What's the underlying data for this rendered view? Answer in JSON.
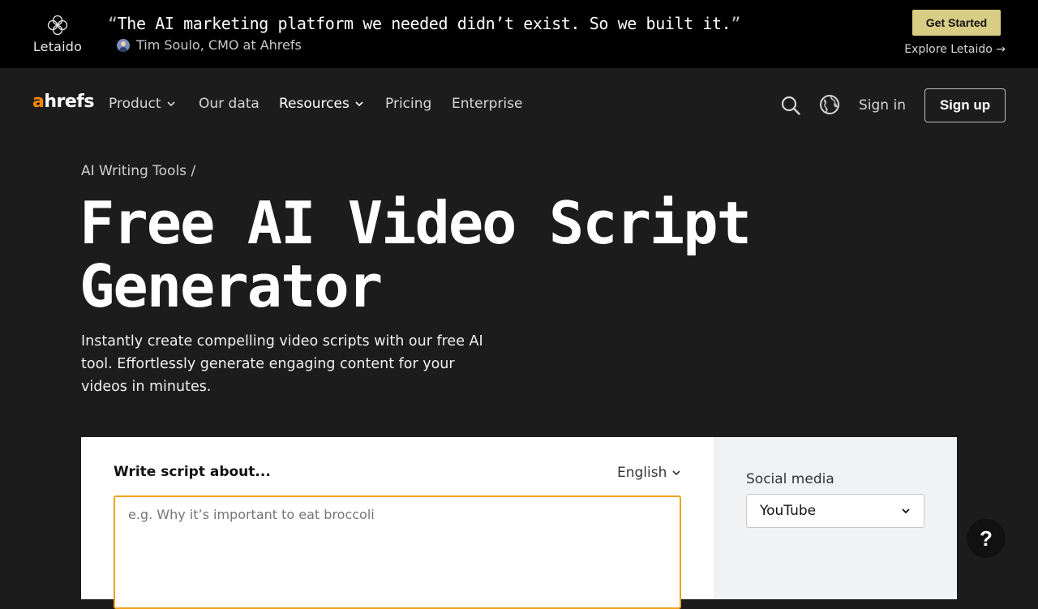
{
  "banner": {
    "brand": "Letaido",
    "quote_open": "“",
    "quote_text": "The AI marketing platform we needed didn’t exist. So we built it.",
    "quote_close": "”",
    "author": "Tim Soulo, CMO at Ahrefs",
    "cta_label": "Get Started",
    "explore_label": "Explore Letaido →",
    "cta_color": "#d8cd84"
  },
  "nav": {
    "logo_a": "a",
    "logo_rest": "hrefs",
    "logo_accent_color": "#ff8800",
    "items": [
      {
        "label": "Product",
        "has_dropdown": true
      },
      {
        "label": "Our data",
        "has_dropdown": false
      },
      {
        "label": "Resources",
        "has_dropdown": true
      },
      {
        "label": "Pricing",
        "has_dropdown": false
      },
      {
        "label": "Enterprise",
        "has_dropdown": false
      }
    ],
    "icons": [
      "search-icon",
      "globe-icon"
    ],
    "signin_label": "Sign in",
    "signup_label": "Sign up"
  },
  "hero": {
    "breadcrumb": "AI Writing Tools /",
    "title_line1": "Free AI Video Script",
    "title_line2": "Generator",
    "description": "Instantly create compelling video scripts with our free AI tool. Effortlessly generate engaging content for your videos in minutes."
  },
  "tool": {
    "input_label": "Write script about...",
    "language": "English",
    "placeholder": "e.g. Why it’s important to eat broccoli",
    "input_border_color": "#f0a11c",
    "social_label": "Social media",
    "social_selected": "YouTube"
  },
  "help": {
    "label": "?"
  }
}
